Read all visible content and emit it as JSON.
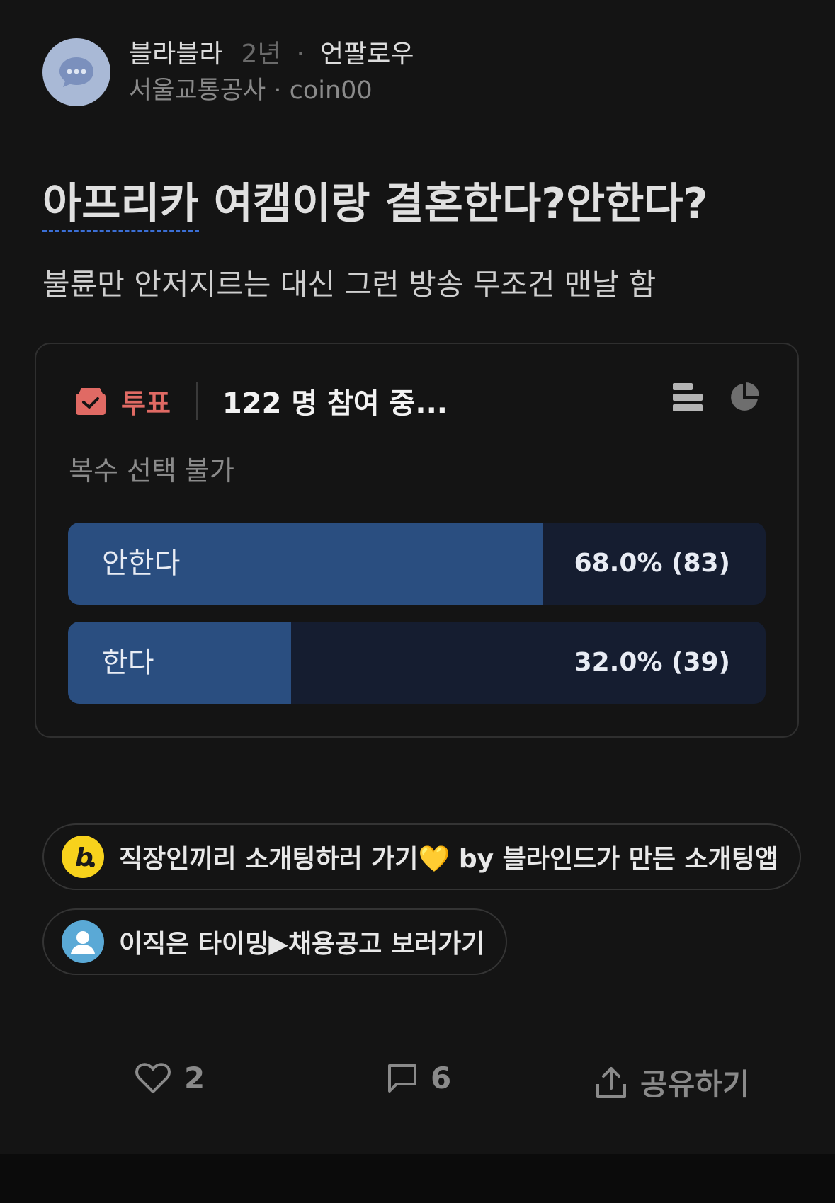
{
  "post": {
    "author": "블라블라",
    "time": "2년",
    "dot": "·",
    "follow_label": "언팔로우",
    "company_line": "서울교통공사 · coin00",
    "title_underlined": "아프리카",
    "title_rest": " 여캠이랑 결혼한다?안한다?",
    "body": "불륜만 안저지르는 대신 그런 방송 무조건 맨날 함"
  },
  "poll": {
    "label": "투표",
    "participants": "122 명 참여 중...",
    "multi_select": "복수 선택 불가",
    "options": [
      {
        "label": "안한다",
        "result": "68.0% (83)",
        "fraction": 0.68
      },
      {
        "label": "한다",
        "result": "32.0% (39)",
        "fraction": 0.32
      }
    ]
  },
  "banners": [
    {
      "text": "직장인끼리 소개팅하러 가기💛 by 블라인드가 만든 소개팅앱",
      "icon": "blind-b-icon"
    },
    {
      "text": "이직은 타이밍▶채용공고 보러가기",
      "icon": "person-icon"
    }
  ],
  "actions": {
    "likes": "2",
    "comments": "6",
    "share": "공유하기"
  },
  "colors": {
    "background": "#141414",
    "poll_accent": "#e06a64",
    "bar_fill": "#2a4e80",
    "bar_track": "#151d30",
    "link_underline": "#3b6fd6"
  }
}
